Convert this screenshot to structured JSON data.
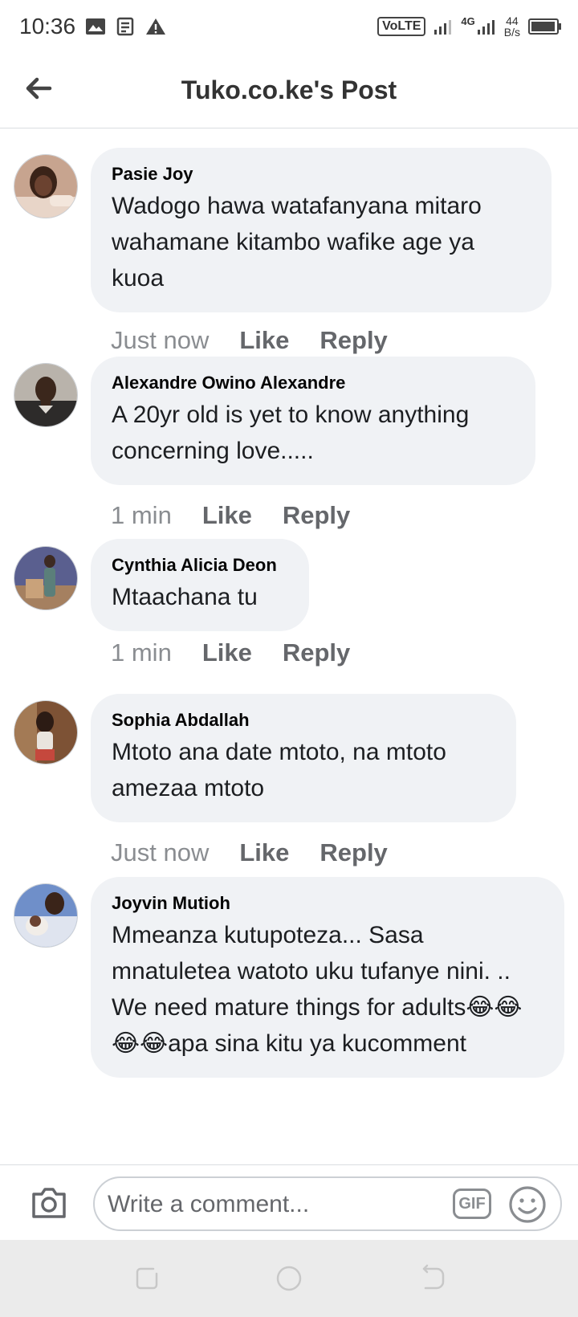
{
  "status_bar": {
    "time": "10:36",
    "network": "VoLTE",
    "data_type": "4G",
    "speed_value": "44",
    "speed_unit": "B/s"
  },
  "header": {
    "title": "Tuko.co.ke's Post"
  },
  "comments": [
    {
      "author": "Pasie Joy",
      "text": "Wadogo hawa watafanyana mitaro wahamane kitambo wafike age ya kuoa",
      "time": "Just now",
      "like": "Like",
      "reply": "Reply"
    },
    {
      "author": "Alexandre Owino Alexandre",
      "text": "A 20yr old is yet to know anything concerning love.....",
      "time": "1 min",
      "like": "Like",
      "reply": "Reply"
    },
    {
      "author": "Cynthia Alicia Deon",
      "text": "Mtaachana tu",
      "time": "1 min",
      "like": "Like",
      "reply": "Reply"
    },
    {
      "author": "Sophia Abdallah",
      "text": "Mtoto ana date mtoto, na mtoto amezaa mtoto",
      "time": "Just now",
      "like": "Like",
      "reply": "Reply"
    },
    {
      "author": "Joyvin Mutioh",
      "text": "Mmeanza kutupoteza... Sasa mnatuletea watoto uku tufanye nini. .. We need mature things for adults😂😂😂😂apa sina kitu ya kucomment",
      "time": "",
      "like": "",
      "reply": ""
    }
  ],
  "composer": {
    "placeholder": "Write a comment...",
    "gif_label": "GIF"
  },
  "colors": {
    "bubble_bg": "#f0f2f5",
    "meta_text": "#65676b",
    "navbar_bg": "#ebebeb"
  },
  "icons": {
    "back": "arrow-left",
    "camera": "camera",
    "emoji": "smiley-face",
    "gif": "gif-badge",
    "nav": [
      "recents-square",
      "home-circle",
      "back-return"
    ]
  }
}
